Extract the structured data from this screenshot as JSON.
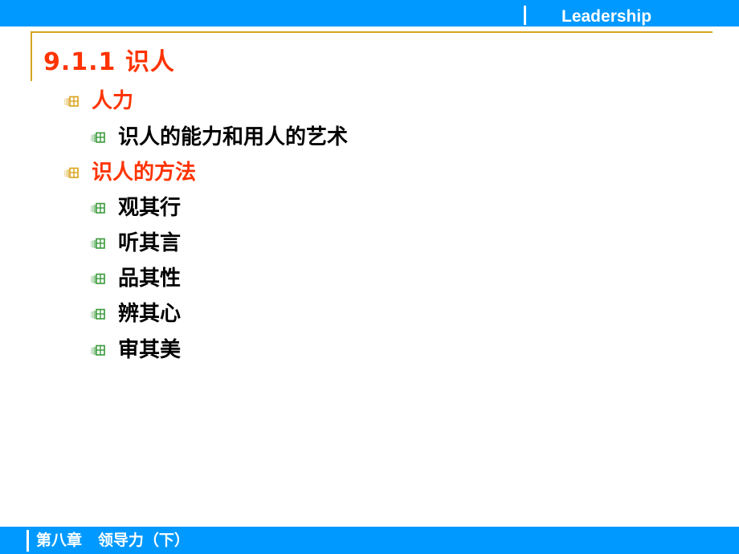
{
  "header": {
    "title": "Leadership",
    "bar_color": "#0099ff"
  },
  "slide": {
    "title": "9.1.1 识人",
    "title_color": "#ff3300",
    "frame_color": "#d4a520",
    "bullets": [
      {
        "level": 1,
        "text": "人力",
        "icon": "window-bullet-icon-gold"
      },
      {
        "level": 2,
        "text": "识人的能力和用人的艺术",
        "icon": "window-bullet-icon-green"
      },
      {
        "level": 1,
        "text": "识人的方法",
        "icon": "window-bullet-icon-gold"
      },
      {
        "level": 2,
        "text": "观其行",
        "icon": "window-bullet-icon-green"
      },
      {
        "level": 2,
        "text": "听其言",
        "icon": "window-bullet-icon-green"
      },
      {
        "level": 2,
        "text": "品其性",
        "icon": "window-bullet-icon-green"
      },
      {
        "level": 2,
        "text": "辨其心",
        "icon": "window-bullet-icon-green"
      },
      {
        "level": 2,
        "text": "审其美",
        "icon": "window-bullet-icon-green"
      }
    ]
  },
  "footer": {
    "chapter": "第八章   领导力（下）"
  }
}
